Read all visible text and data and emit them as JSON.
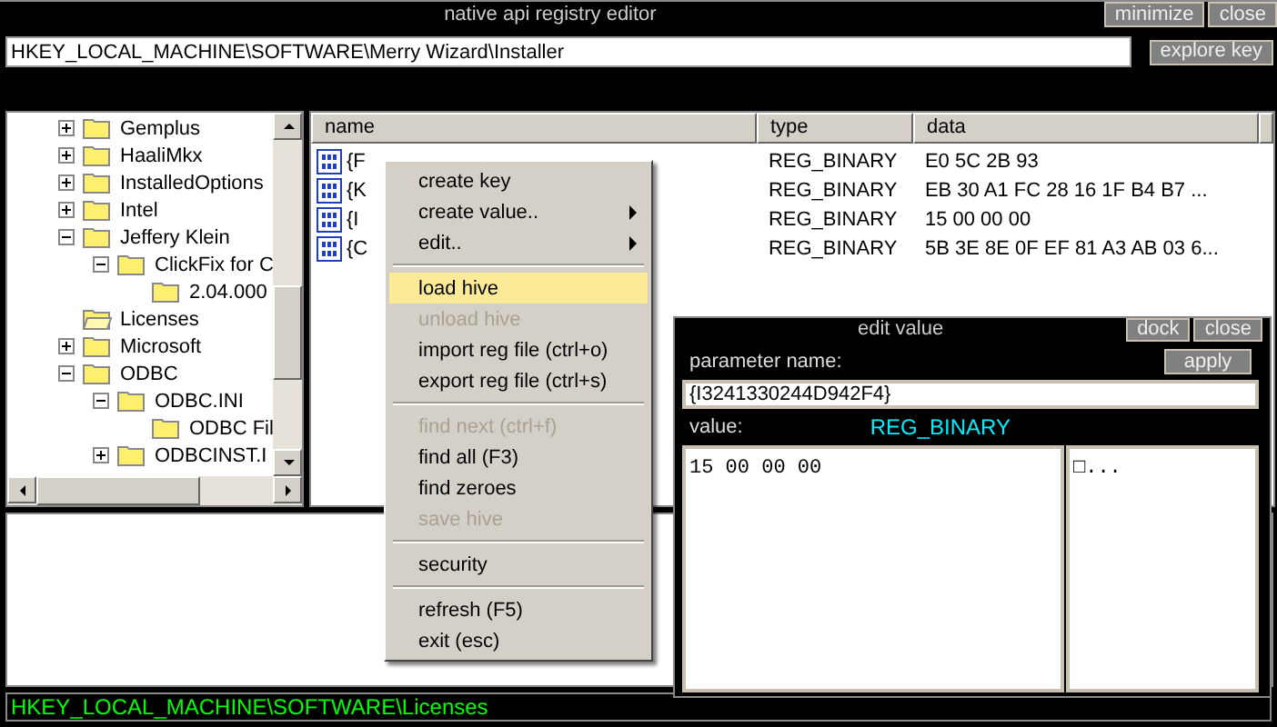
{
  "window": {
    "title": "native api registry editor",
    "buttons": [
      "minimize",
      "close"
    ]
  },
  "address": {
    "value": "HKEY_LOCAL_MACHINE\\SOFTWARE\\Merry Wizard\\Installer",
    "button": "explore key"
  },
  "tree": [
    {
      "label": "Gemplus",
      "kind": "branch",
      "expanded": false,
      "selected": false
    },
    {
      "label": "HaaliMkx",
      "kind": "branch",
      "expanded": false,
      "selected": false
    },
    {
      "label": "InstalledOptions",
      "kind": "branch",
      "expanded": false,
      "selected": false
    },
    {
      "label": "Intel",
      "kind": "branch",
      "expanded": false,
      "selected": false
    },
    {
      "label": "Jeffery Klein",
      "kind": "branch",
      "expanded": true,
      "selected": false,
      "children": [
        {
          "label": "ClickFix for C",
          "kind": "branch",
          "expanded": true,
          "selected": false,
          "children": [
            {
              "label": "2.04.000",
              "kind": "leaf",
              "selected": false
            }
          ]
        }
      ]
    },
    {
      "label": "Licenses",
      "kind": "leaf",
      "selected": true
    },
    {
      "label": "Microsoft",
      "kind": "branch",
      "expanded": false,
      "selected": false
    },
    {
      "label": "ODBC",
      "kind": "branch",
      "expanded": true,
      "selected": false,
      "children": [
        {
          "label": "ODBC.INI",
          "kind": "branch",
          "expanded": true,
          "selected": false,
          "children": [
            {
              "label": "ODBC Fil",
              "kind": "leaf",
              "selected": false
            }
          ]
        },
        {
          "label": "ODBCINST.I",
          "kind": "branch",
          "expanded": false,
          "selected": false
        }
      ]
    }
  ],
  "table": {
    "columns": [
      "name",
      "type",
      "data"
    ],
    "rows": [
      {
        "name": "{F",
        "type": "REG_BINARY",
        "data": "E0 5C 2B 93"
      },
      {
        "name": "{K",
        "type": "REG_BINARY",
        "data": "EB 30 A1 FC 28 16 1F B4 B7 ..."
      },
      {
        "name": "{I",
        "type": "REG_BINARY",
        "data": "15 00 00 00"
      },
      {
        "name": "{C",
        "type": "REG_BINARY",
        "data": "5B 3E 8E 0F EF 81 A3 AB 03 6..."
      }
    ]
  },
  "context_menu": [
    {
      "kind": "item",
      "label": "create key",
      "submenu": false,
      "disabled": false,
      "selected": false
    },
    {
      "kind": "item",
      "label": "create value..",
      "submenu": true,
      "disabled": false,
      "selected": false
    },
    {
      "kind": "item",
      "label": "edit..",
      "submenu": true,
      "disabled": false,
      "selected": false
    },
    {
      "kind": "separator"
    },
    {
      "kind": "item",
      "label": "load hive",
      "submenu": false,
      "disabled": false,
      "selected": true
    },
    {
      "kind": "item",
      "label": "unload hive",
      "submenu": false,
      "disabled": true,
      "selected": false
    },
    {
      "kind": "item",
      "label": "import reg file (ctrl+o)",
      "submenu": false,
      "disabled": false,
      "selected": false
    },
    {
      "kind": "item",
      "label": "export reg file (ctrl+s)",
      "submenu": false,
      "disabled": false,
      "selected": false
    },
    {
      "kind": "separator"
    },
    {
      "kind": "item",
      "label": "find next (ctrl+f)",
      "submenu": false,
      "disabled": true,
      "selected": false
    },
    {
      "kind": "item",
      "label": "find all (F3)",
      "submenu": false,
      "disabled": false,
      "selected": false
    },
    {
      "kind": "item",
      "label": "find zeroes",
      "submenu": false,
      "disabled": false,
      "selected": false
    },
    {
      "kind": "item",
      "label": "save hive",
      "submenu": false,
      "disabled": true,
      "selected": false
    },
    {
      "kind": "separator"
    },
    {
      "kind": "item",
      "label": "security",
      "submenu": false,
      "disabled": false,
      "selected": false
    },
    {
      "kind": "separator"
    },
    {
      "kind": "item",
      "label": "refresh (F5)",
      "submenu": false,
      "disabled": false,
      "selected": false
    },
    {
      "kind": "item",
      "label": "exit (esc)",
      "submenu": false,
      "disabled": false,
      "selected": false
    }
  ],
  "edit_value": {
    "title": "edit value",
    "buttons": [
      "dock",
      "close"
    ],
    "name_label": "parameter name:",
    "apply": "apply",
    "name_value": "{I3241330244D942F4}",
    "value_label": "value:",
    "value_type": "REG_BINARY",
    "hex": "15 00 00 00",
    "ascii": "□..."
  },
  "status_bar": "HKEY_LOCAL_MACHINE\\SOFTWARE\\Licenses"
}
